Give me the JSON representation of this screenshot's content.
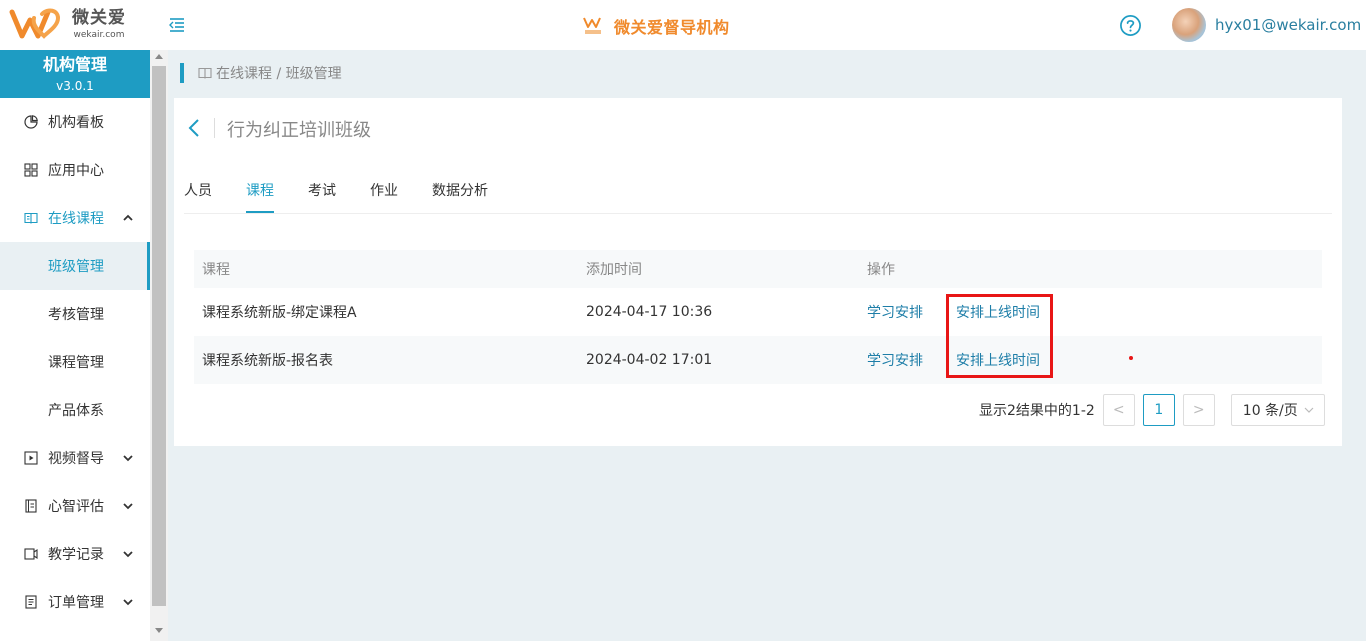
{
  "header": {
    "logo_cn": "微关爱",
    "logo_en": "wekair.com",
    "brand_mini": "微关爱",
    "brand_title": "微关爱督导机构",
    "user_email": "hyx01@wekair.com"
  },
  "sidebar": {
    "title": "机构管理",
    "version": "v3.0.1",
    "items": [
      {
        "label": "机构看板",
        "icon": "pie-chart-icon"
      },
      {
        "label": "应用中心",
        "icon": "grid-icon"
      },
      {
        "label": "在线课程",
        "icon": "book-icon",
        "expanded": true
      },
      {
        "label": "视频督导",
        "icon": "video-icon"
      },
      {
        "label": "心智评估",
        "icon": "notebook-icon"
      },
      {
        "label": "教学记录",
        "icon": "record-icon"
      },
      {
        "label": "订单管理",
        "icon": "order-icon"
      }
    ],
    "subitems": [
      {
        "label": "班级管理",
        "active": true
      },
      {
        "label": "考核管理"
      },
      {
        "label": "课程管理"
      },
      {
        "label": "产品体系"
      }
    ]
  },
  "breadcrumb": {
    "text": "在线课程 / 班级管理"
  },
  "page": {
    "title": "行为纠正培训班级",
    "tabs": [
      "人员",
      "课程",
      "考试",
      "作业",
      "数据分析"
    ],
    "active_tab": "课程"
  },
  "table": {
    "headers": [
      "课程",
      "添加时间",
      "操作"
    ],
    "rows": [
      {
        "course": "课程系统新版-绑定课程A",
        "time": "2024-04-17 10:36",
        "action1": "学习安排",
        "action2": "安排上线时间"
      },
      {
        "course": "课程系统新版-报名表",
        "time": "2024-04-02 17:01",
        "action1": "学习安排",
        "action2": "安排上线时间"
      }
    ]
  },
  "pagination": {
    "summary": "显示2结果中的1-2",
    "prev": "<",
    "current": "1",
    "next": ">",
    "page_size": "10 条/页"
  },
  "colors": {
    "accent": "#1e9cc3",
    "brand": "#f08a2c",
    "highlight": "#e81616"
  }
}
